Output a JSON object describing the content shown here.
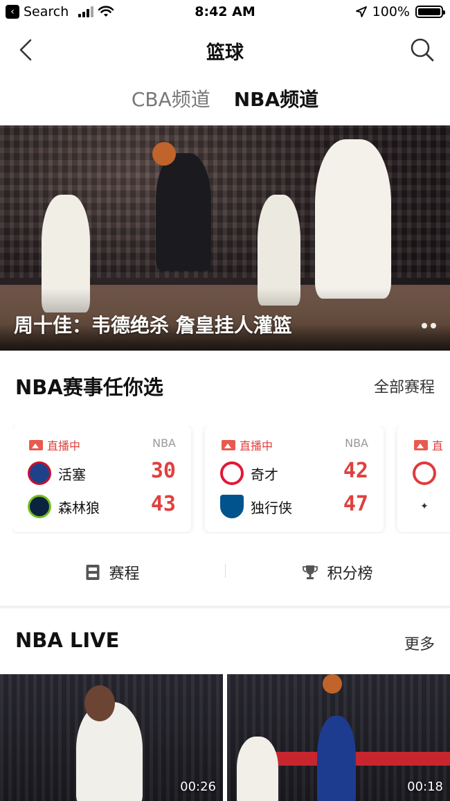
{
  "status_bar": {
    "back_app": "Search",
    "time": "8:42 AM",
    "battery": "100%"
  },
  "nav": {
    "title": "篮球"
  },
  "tabs": [
    {
      "label": "CBA频道",
      "active": false
    },
    {
      "label": "NBA频道",
      "active": true
    }
  ],
  "banner": {
    "caption": "周十佳：韦德绝杀 詹皇挂人灌篮",
    "page_count": 2
  },
  "events": {
    "title": "NBA赛事任你选",
    "more": "全部赛程",
    "matches": [
      {
        "status": "直播中",
        "league": "NBA",
        "home": {
          "name": "活塞",
          "score": "30",
          "color": "#1d428a"
        },
        "away": {
          "name": "森林狼",
          "score": "43",
          "color": "#0c2340"
        }
      },
      {
        "status": "直播中",
        "league": "NBA",
        "home": {
          "name": "奇才",
          "score": "42",
          "color": "#e31837"
        },
        "away": {
          "name": "独行侠",
          "score": "47",
          "color": "#00538c"
        }
      },
      {
        "status": "直",
        "league": "",
        "home": {
          "name": "",
          "score": "",
          "color": "#e03a3e"
        },
        "away": {
          "name": "",
          "score": "",
          "color": "#333333"
        }
      }
    ]
  },
  "quick_links": [
    {
      "label": "赛程",
      "icon": "schedule-icon"
    },
    {
      "label": "积分榜",
      "icon": "trophy-icon"
    }
  ],
  "live": {
    "title": "NBA LIVE",
    "more": "更多",
    "videos": [
      {
        "duration": "00:26"
      },
      {
        "duration": "00:18"
      }
    ]
  },
  "colors": {
    "accent_red": "#e0403d",
    "text": "#111111"
  }
}
